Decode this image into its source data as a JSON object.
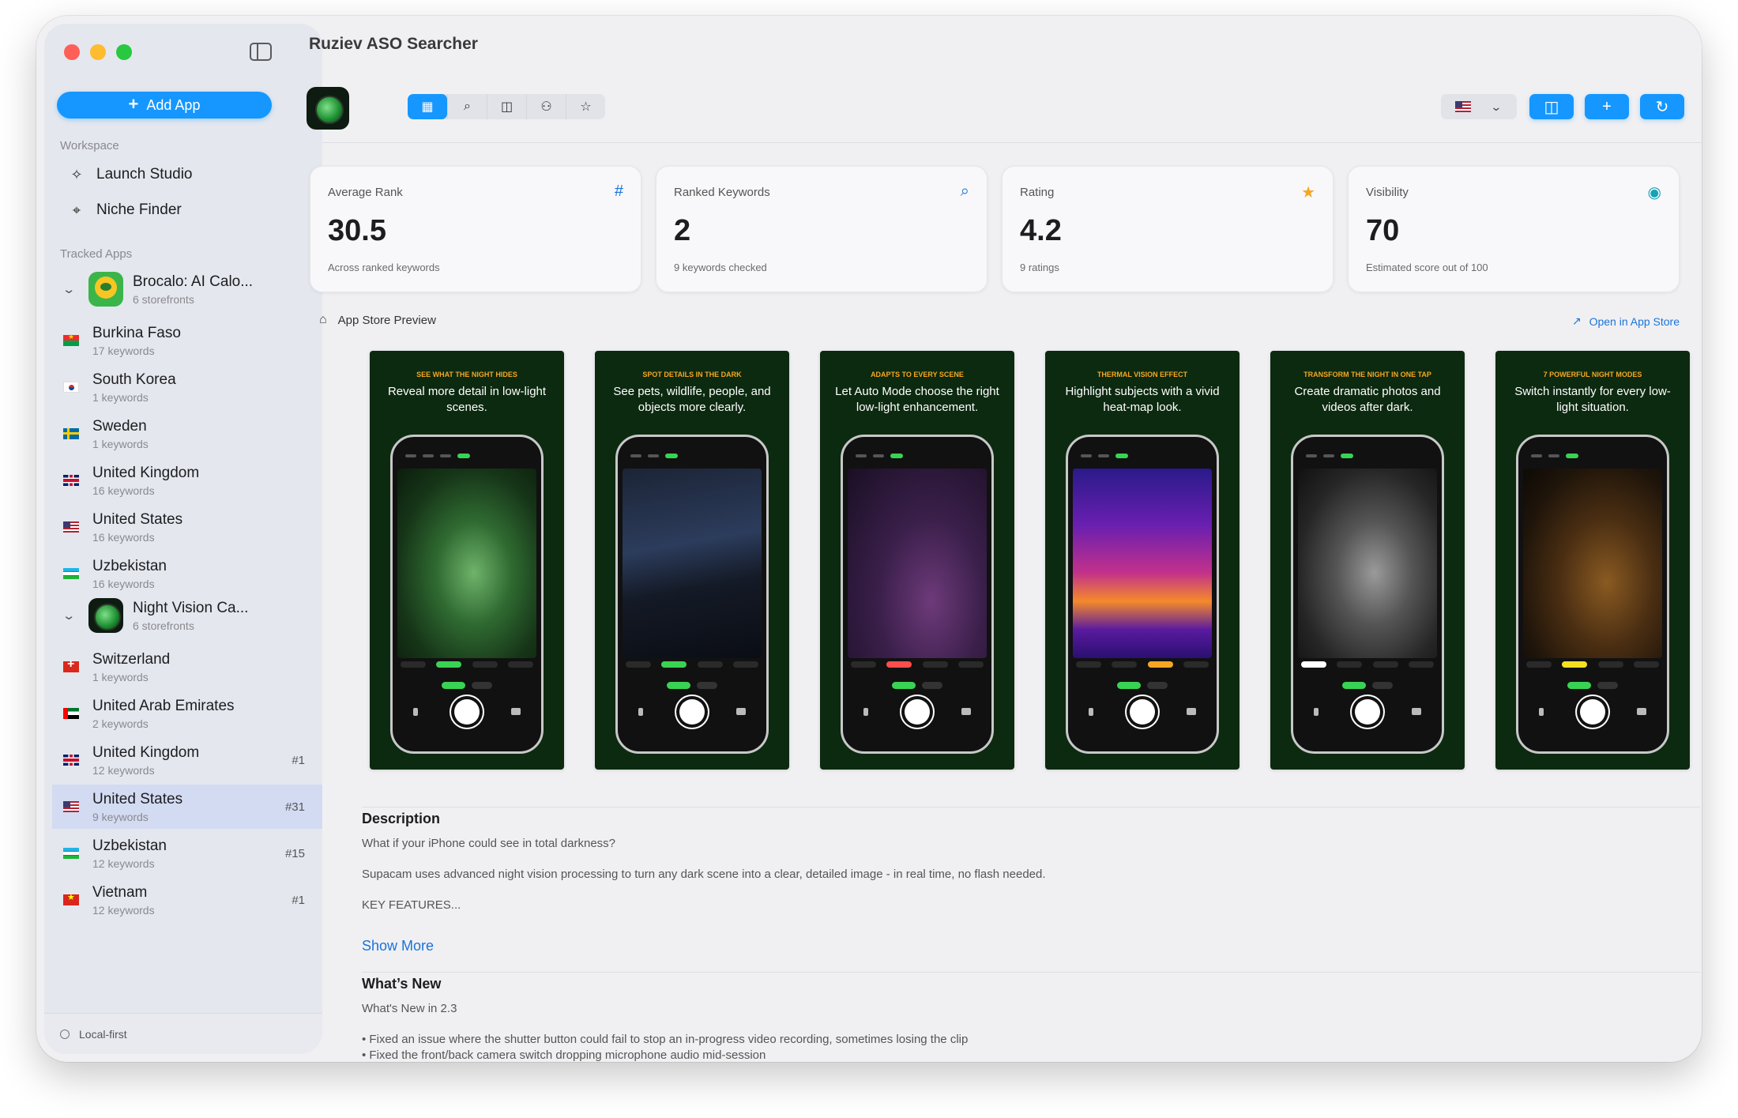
{
  "sidebar": {
    "add_app_label": "Add App",
    "workspace_label": "Workspace",
    "workspace_items": [
      {
        "label": "Launch Studio",
        "icon": "sparkle-icon"
      },
      {
        "label": "Niche Finder",
        "icon": "crosshair-icon"
      }
    ],
    "tracked_label": "Tracked Apps",
    "apps": [
      {
        "name": "Brocalo: AI Calo...",
        "storefronts": "6 storefronts",
        "stores": [
          {
            "country": "Burkina Faso",
            "keywords": "17 keywords",
            "rank": ""
          },
          {
            "country": "South Korea",
            "keywords": "1 keywords",
            "rank": ""
          },
          {
            "country": "Sweden",
            "keywords": "1 keywords",
            "rank": ""
          },
          {
            "country": "United Kingdom",
            "keywords": "16 keywords",
            "rank": ""
          },
          {
            "country": "United States",
            "keywords": "16 keywords",
            "rank": ""
          },
          {
            "country": "Uzbekistan",
            "keywords": "16 keywords",
            "rank": ""
          }
        ]
      },
      {
        "name": "Night Vision Ca...",
        "storefronts": "6 storefronts",
        "stores": [
          {
            "country": "Switzerland",
            "keywords": "1 keywords",
            "rank": ""
          },
          {
            "country": "United Arab Emirates",
            "keywords": "2 keywords",
            "rank": ""
          },
          {
            "country": "United Kingdom",
            "keywords": "12 keywords",
            "rank": "#1"
          },
          {
            "country": "United States",
            "keywords": "9 keywords",
            "rank": "#31",
            "selected": true
          },
          {
            "country": "Uzbekistan",
            "keywords": "12 keywords",
            "rank": "#15"
          },
          {
            "country": "Vietnam",
            "keywords": "12 keywords",
            "rank": "#1"
          }
        ]
      }
    ],
    "footer": "Local-first"
  },
  "header": {
    "title": "Ruziev ASO Searcher"
  },
  "stats": [
    {
      "label": "Average Rank",
      "value": "30.5",
      "sub": "Across ranked keywords",
      "icon": "hash-icon",
      "icon_color": "#1a73d9"
    },
    {
      "label": "Ranked Keywords",
      "value": "2",
      "sub": "9 keywords checked",
      "icon": "magnifier-icon",
      "icon_color": "#1a73d9"
    },
    {
      "label": "Rating",
      "value": "4.2",
      "sub": "9 ratings",
      "icon": "star-icon",
      "icon_color": "#f5a623"
    },
    {
      "label": "Visibility",
      "value": "70",
      "sub": "Estimated score out of 100",
      "icon": "eye-icon",
      "icon_color": "#16a3b8"
    }
  ],
  "preview": {
    "label": "App Store Preview",
    "open_label": "Open in App Store",
    "screenshots": [
      {
        "kicker": "SEE WHAT THE NIGHT HIDES",
        "headline": "Reveal more detail in low-light scenes.",
        "scene": "green"
      },
      {
        "kicker": "SPOT DETAILS IN THE DARK",
        "headline": "See pets, wildlife, people, and objects more clearly.",
        "scene": "blue"
      },
      {
        "kicker": "ADAPTS TO EVERY SCENE",
        "headline": "Let Auto Mode choose the right low-light enhancement.",
        "scene": "purple"
      },
      {
        "kicker": "THERMAL VISION EFFECT",
        "headline": "Highlight subjects with a vivid heat-map look.",
        "scene": "thermal"
      },
      {
        "kicker": "TRANSFORM THE NIGHT IN ONE TAP",
        "headline": "Create dramatic photos and videos after dark.",
        "scene": "mono"
      },
      {
        "kicker": "7 POWERFUL NIGHT MODES",
        "headline": "Switch instantly for every low-light situation.",
        "scene": "amber"
      }
    ]
  },
  "description": {
    "heading": "Description",
    "line1": "What if your iPhone could see in total darkness?",
    "line2": "Supacam uses advanced night vision processing to turn any dark scene into a clear, detailed image - in real time, no flash needed.",
    "line3": "KEY FEATURES...",
    "show_more": "Show More"
  },
  "whats_new": {
    "heading": "What’s New",
    "version": "What's New in 2.3",
    "items": [
      "• Fixed an issue where the shutter button could fail to stop an in-progress video recording, sometimes losing the clip",
      "• Fixed the front/back camera switch dropping microphone audio mid-session"
    ]
  },
  "colors": {
    "accent": "#1597ff",
    "link": "#1a73d9",
    "selected_row": "#d3dbf2"
  }
}
